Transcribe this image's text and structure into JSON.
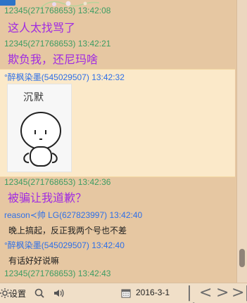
{
  "top": {
    "tab_label": "",
    "flower_icon": "flower-icon"
  },
  "messages": [
    {
      "meta": "12345(271768653) 13:42:08",
      "text": "这人太找骂了"
    },
    {
      "meta": "12345(271768653) 13:42:21",
      "text": "欺负我，还尼玛啥"
    },
    {
      "meta": "°醉枫染墨(545029507) 13:42:32",
      "sticker_text": "沉默"
    },
    {
      "meta": "12345(271768653) 13:42:36",
      "text": "被骗让我道歉？"
    },
    {
      "meta": "reason≺帅 LG(627823997) 13:42:40",
      "text": "晚上搞起，反正我两个号也不差"
    },
    {
      "meta": "°醉枫染墨(545029507) 13:42:40",
      "text": "有话好好说嘛"
    },
    {
      "meta": "12345(271768653) 13:42:43"
    }
  ],
  "bottom_bar": {
    "settings_label": "设置",
    "date": "2016-3-1",
    "icons": {
      "settings": "gear-icon",
      "search": "search-icon",
      "sound": "speaker-icon",
      "calendar": "calendar-icon",
      "first": "first-page-icon",
      "prev": "prev-page-icon",
      "next": "next-page-icon",
      "last": "last-page-icon"
    }
  },
  "scroll": {
    "position": 0.92
  },
  "colors": {
    "background": "#e6c7a2",
    "highlight": "#fbe9c9",
    "meta_green": "#3e9d63",
    "meta_blue": "#2e6fe8",
    "purple_text": "#a12ce1",
    "dark_text": "#1f1f1f"
  }
}
